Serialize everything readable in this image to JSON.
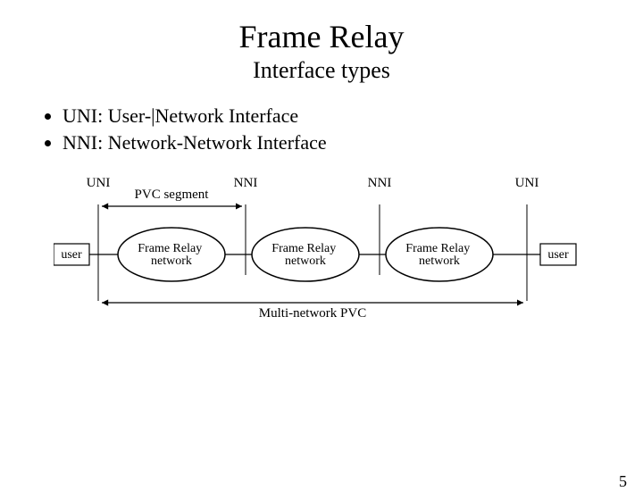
{
  "title": "Frame Relay",
  "subtitle": "Interface types",
  "bullets": [
    "UNI: User-|Network Interface",
    "NNI: Network-Network Interface"
  ],
  "diagram": {
    "labels": {
      "uni_left": "UNI",
      "nni_left": "NNI",
      "nni_right": "NNI",
      "uni_right": "UNI",
      "pvc_segment": "PVC segment",
      "multi_pvc": "Multi-network PVC",
      "user_left": "user",
      "user_right": "user",
      "network": "Frame Relay\nnetwork"
    }
  },
  "page_number": "5"
}
